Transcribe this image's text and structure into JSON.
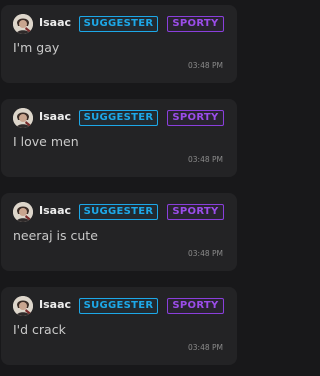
{
  "messages": [
    {
      "user": "Isaac",
      "badges": [
        "SUGGESTER",
        "SPORTY"
      ],
      "text": "I'm gay",
      "time": "03:48 PM"
    },
    {
      "user": "Isaac",
      "badges": [
        "SUGGESTER",
        "SPORTY"
      ],
      "text": "I love men",
      "time": "03:48 PM"
    },
    {
      "user": "Isaac",
      "badges": [
        "SUGGESTER",
        "SPORTY"
      ],
      "text": "neeraj is cute",
      "time": "03:48 PM"
    },
    {
      "user": "Isaac",
      "badges": [
        "SUGGESTER",
        "SPORTY"
      ],
      "text": "I'd crack",
      "time": "03:48 PM"
    }
  ],
  "colors": {
    "suggester_badge": "#1da8e8",
    "sporty_badge": "#9b4dea",
    "card_background": "#232325"
  },
  "icons": {
    "avatar": "user-avatar-icon"
  }
}
